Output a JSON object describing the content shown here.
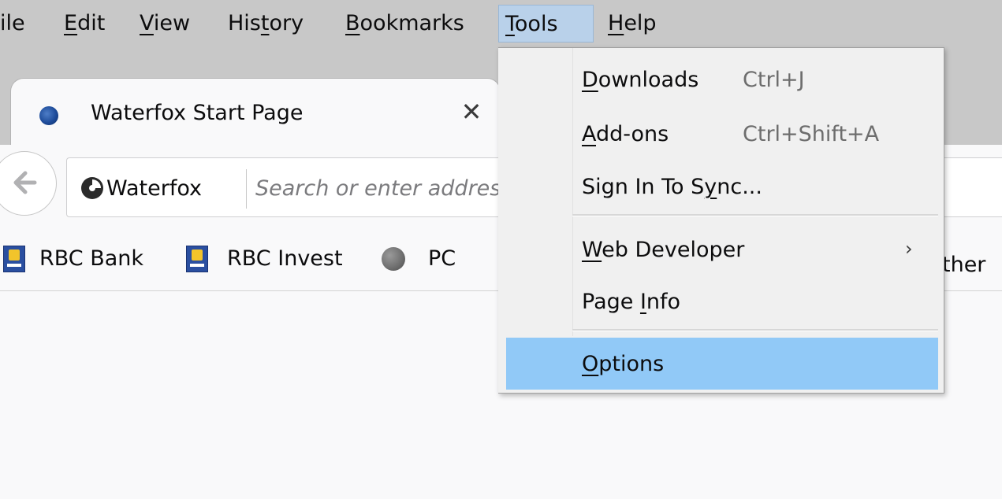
{
  "menubar": {
    "items": [
      {
        "id": "file",
        "text": "File",
        "prefix": "",
        "accel": "F",
        "suffix": "ile",
        "visible": "ile"
      },
      {
        "id": "edit",
        "prefix": "",
        "accel": "E",
        "suffix": "dit"
      },
      {
        "id": "view",
        "prefix": "",
        "accel": "V",
        "suffix": "iew"
      },
      {
        "id": "history",
        "prefix": "His",
        "accel": "t",
        "suffix": "ory"
      },
      {
        "id": "bookmarks",
        "prefix": "",
        "accel": "B",
        "suffix": "ookmarks"
      },
      {
        "id": "tools",
        "prefix": "",
        "accel": "T",
        "suffix": "ools"
      },
      {
        "id": "help",
        "prefix": "",
        "accel": "H",
        "suffix": "elp"
      }
    ]
  },
  "tab": {
    "title": "Waterfox Start Page",
    "close_glyph": "✕"
  },
  "navbar": {
    "identity_label": "Waterfox",
    "url_placeholder": "Search or enter address",
    "back_icon": "back-arrow-icon"
  },
  "bookmarks": {
    "items": [
      {
        "label": "RBC Bank",
        "icon": "rbc-icon"
      },
      {
        "label": "RBC Invest",
        "icon": "rbc-icon"
      },
      {
        "label": "PC",
        "icon": "globe-icon"
      }
    ],
    "other_visible": "ther"
  },
  "tools_menu": {
    "downloads": {
      "prefix": "",
      "accel": "D",
      "suffix": "ownloads",
      "shortcut": "Ctrl+J"
    },
    "addons": {
      "prefix": "",
      "accel": "A",
      "suffix": "dd-ons",
      "shortcut": "Ctrl+Shift+A"
    },
    "sync": {
      "prefix": "Sign In To S",
      "accel": "y",
      "suffix": "nc..."
    },
    "webdev": {
      "prefix": "",
      "accel": "W",
      "suffix": "eb Developer",
      "arrow": "›"
    },
    "pageinfo": {
      "prefix": "Page ",
      "accel": "I",
      "suffix": "nfo"
    },
    "options": {
      "prefix": "",
      "accel": "O",
      "suffix": "ptions"
    }
  },
  "colors": {
    "menu_tools_active": "#b9d1ea",
    "menu_hover": "#91c9f7",
    "chrome_bg": "#c8c8c8"
  }
}
